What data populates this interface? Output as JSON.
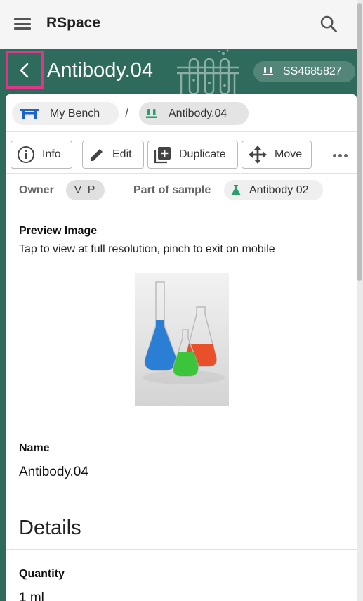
{
  "appbar": {
    "title": "RSpace",
    "menu_icon": "hamburger-menu-icon",
    "search_icon": "search-icon"
  },
  "header": {
    "record_name": "Antibody.04",
    "global_id": "SS4685827",
    "back_icon": "chevron-left-icon",
    "accent_color": "#2e6b5c",
    "highlight_color": "#e0368a"
  },
  "breadcrumb": {
    "items": [
      {
        "label": "My Bench",
        "icon": "bench-icon"
      },
      {
        "label": "Antibody.04",
        "icon": "subsample-icon"
      }
    ],
    "separator": "/"
  },
  "toolbar": {
    "info_label": "Info",
    "edit_label": "Edit",
    "duplicate_label": "Duplicate",
    "move_label": "Move",
    "more_icon": "more-horizontal-icon"
  },
  "meta": {
    "owner_label": "Owner",
    "owner_initials": "V P",
    "parent_label": "Part of sample",
    "parent_name": "Antibody 02"
  },
  "preview": {
    "label": "Preview Image",
    "hint": "Tap to view at full resolution, pinch to exit on mobile"
  },
  "fields": {
    "name_label": "Name",
    "name_value": "Antibody.04",
    "details_heading": "Details",
    "quantity_label": "Quantity",
    "quantity_value": "1 ml"
  }
}
